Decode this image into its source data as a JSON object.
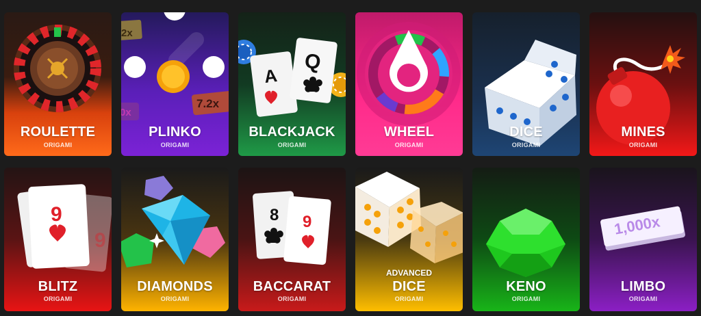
{
  "games": [
    {
      "id": "roulette",
      "title": "ROULETTE",
      "provider": "ORIGAMI"
    },
    {
      "id": "plinko",
      "title": "PLINKO",
      "provider": "ORIGAMI",
      "badges": [
        "2x",
        "7.2x",
        "0x"
      ]
    },
    {
      "id": "blackjack",
      "title": "BLACKJACK",
      "provider": "ORIGAMI",
      "cards": [
        "A",
        "Q"
      ]
    },
    {
      "id": "wheel",
      "title": "WHEEL",
      "provider": "ORIGAMI"
    },
    {
      "id": "dice",
      "title": "DICE",
      "provider": "ORIGAMI"
    },
    {
      "id": "mines",
      "title": "MINES",
      "provider": "ORIGAMI"
    },
    {
      "id": "blitz",
      "title": "BLITZ",
      "provider": "ORIGAMI",
      "cards": [
        "9",
        "9"
      ]
    },
    {
      "id": "diamonds",
      "title": "DIAMONDS",
      "provider": "ORIGAMI"
    },
    {
      "id": "baccarat",
      "title": "BACCARAT",
      "provider": "ORIGAMI",
      "cards": [
        "8",
        "9"
      ]
    },
    {
      "id": "advanced_dice",
      "title": "DICE",
      "supertitle": "ADVANCED",
      "provider": "ORIGAMI"
    },
    {
      "id": "keno",
      "title": "KENO",
      "provider": "ORIGAMI"
    },
    {
      "id": "limbo",
      "title": "LIMBO",
      "provider": "ORIGAMI",
      "multiplier": "1,000x"
    }
  ],
  "colors": {
    "page_bg": "#1c1c1c",
    "roulette": "#ff5a14",
    "plinko": "#7b22d6",
    "blackjack": "#1f9a47",
    "wheel": "#ff2a8a",
    "dice": "#1a3d66",
    "mines": "#f31818",
    "blitz": "#e81414",
    "diamonds": "#ffb300",
    "baccarat": "#c81a1a",
    "advanced_dice": "#ffbe00",
    "keno": "#18b418",
    "limbo": "#8b1fc4"
  }
}
